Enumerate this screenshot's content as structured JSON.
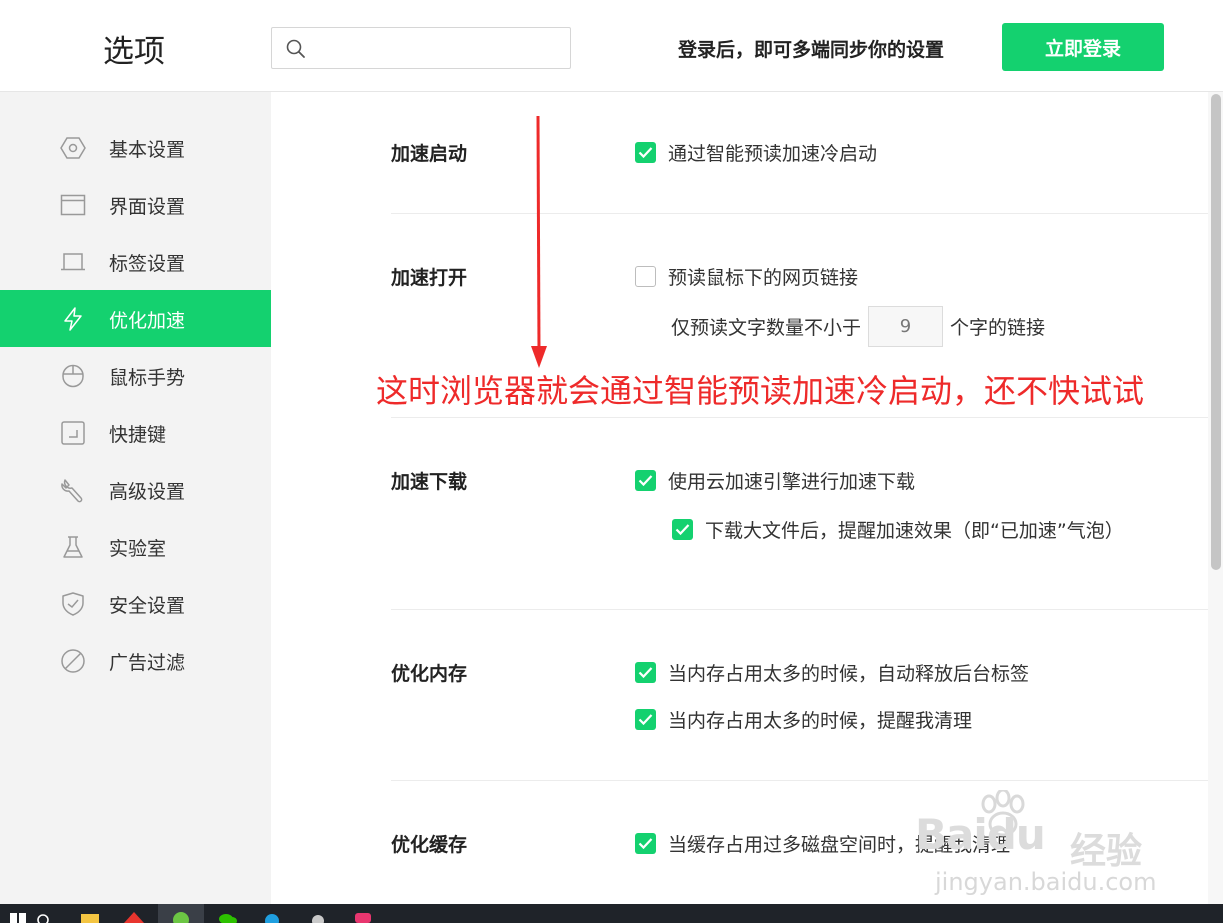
{
  "header": {
    "title": "选项",
    "search_placeholder": "",
    "sync_tip": "登录后，即可多端同步你的设置",
    "login_button": "立即登录"
  },
  "sidebar": {
    "items": [
      {
        "label": "基本设置",
        "icon": "hexagon-gear-icon",
        "active": false
      },
      {
        "label": "界面设置",
        "icon": "window-icon",
        "active": false
      },
      {
        "label": "标签设置",
        "icon": "tab-icon",
        "active": false
      },
      {
        "label": "优化加速",
        "icon": "lightning-icon",
        "active": true
      },
      {
        "label": "鼠标手势",
        "icon": "mouse-icon",
        "active": false
      },
      {
        "label": "快捷键",
        "icon": "keyboard-shortcut-icon",
        "active": false
      },
      {
        "label": "高级设置",
        "icon": "wrench-icon",
        "active": false
      },
      {
        "label": "实验室",
        "icon": "flask-icon",
        "active": false
      },
      {
        "label": "安全设置",
        "icon": "shield-check-icon",
        "active": false
      },
      {
        "label": "广告过滤",
        "icon": "block-icon",
        "active": false
      }
    ]
  },
  "content": {
    "sections": [
      {
        "title": "加速启动",
        "options": [
          {
            "label": "通过智能预读加速冷启动",
            "checked": true
          }
        ]
      },
      {
        "title": "加速打开",
        "options": [
          {
            "label": "预读鼠标下的网页链接",
            "checked": false
          }
        ],
        "sub": {
          "prefix": "仅预读文字数量不小于",
          "value": "9",
          "suffix": "个字的链接"
        }
      },
      {
        "title": "加速下载",
        "options": [
          {
            "label": "使用云加速引擎进行加速下载",
            "checked": true
          },
          {
            "label": "下载大文件后，提醒加速效果（即“已加速”气泡）",
            "checked": true
          }
        ]
      },
      {
        "title": "优化内存",
        "options": [
          {
            "label": "当内存占用太多的时候，自动释放后台标签",
            "checked": true
          },
          {
            "label": "当内存占用太多的时候，提醒我清理",
            "checked": true
          }
        ]
      },
      {
        "title": "优化缓存",
        "options": [
          {
            "label": "当缓存占用过多磁盘空间时，提醒我清理",
            "checked": true
          }
        ]
      }
    ]
  },
  "annotation": {
    "text": "这时浏览器就会通过智能预读加速冷启动，还不快试试",
    "color": "#ee2a2a"
  },
  "watermark": {
    "brand": "Baidu",
    "jingyan": "经验",
    "url": "jingyan.baidu.com"
  },
  "colors": {
    "accent": "#14d16f",
    "sidebar_bg": "#f3f3f3",
    "taskbar_bg": "#1f2329"
  }
}
